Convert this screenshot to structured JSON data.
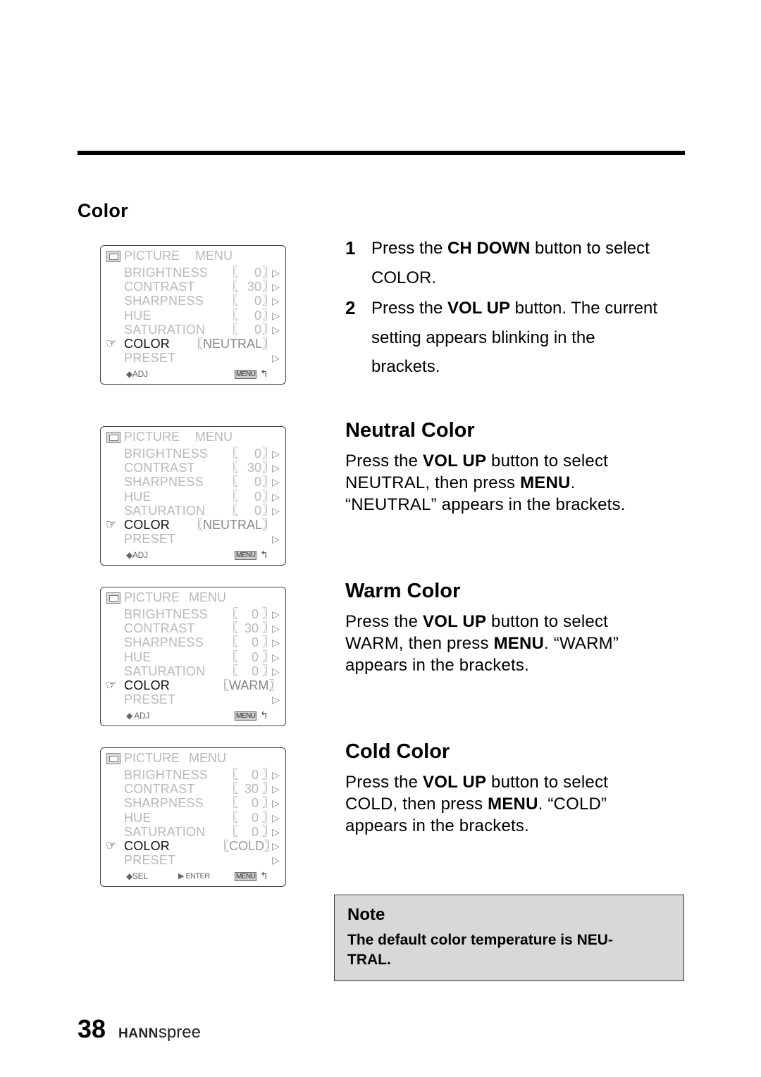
{
  "section": {
    "title": "Color"
  },
  "steps": [
    {
      "num": "1",
      "pre": "Press the ",
      "bold": "CH DOWN",
      "post": " button to select COLOR."
    },
    {
      "num": "2",
      "pre": "Press the ",
      "bold": "VOL UP",
      "post": " button. The current setting appears blinking in the brackets."
    }
  ],
  "osd_common": {
    "title_left": "PICTURE",
    "title_right": "MENU",
    "bracket_left": "〖",
    "bracket_right": "〗",
    "arrow": "▷",
    "hand_icon": "☞",
    "return_icon": "↰",
    "menu_key": "MENU",
    "rows": [
      {
        "label": "BRIGHTNESS",
        "value": "0"
      },
      {
        "label": "CONTRAST",
        "value": "30"
      },
      {
        "label": "SHARPNESS",
        "value": "0"
      },
      {
        "label": "HUE",
        "value": "0"
      },
      {
        "label": "SATURATION",
        "value": "0"
      }
    ],
    "color_label": "COLOR",
    "preset_label": "PRESET"
  },
  "osd_panels": [
    {
      "color_value": "NEUTRAL",
      "footer_left": "◆ADJ",
      "footer_mid": ""
    },
    {
      "color_value": "NEUTRAL",
      "footer_left": "◆ADJ",
      "footer_mid": ""
    },
    {
      "color_value": "WARM",
      "footer_left": "◆ ADJ",
      "footer_mid": ""
    },
    {
      "color_value": "COLD",
      "footer_left": "◆SEL",
      "footer_mid": "▶ ENTER"
    }
  ],
  "sections": [
    {
      "heading": "Neutral Color",
      "pre": "Press the ",
      "b1": "VOL UP",
      "mid": " button to select NEUTRAL, then press ",
      "b2": "MENU",
      "post": ". “NEUTRAL” appears in the brackets."
    },
    {
      "heading": "Warm Color",
      "pre": "Press the ",
      "b1": "VOL UP",
      "mid": " button to select WARM, then press ",
      "b2": "MENU",
      "post": ". “WARM” appears in the brackets."
    },
    {
      "heading": "Cold Color",
      "pre": "Press the ",
      "b1": "VOL UP",
      "mid": " button to select COLD, then press ",
      "b2": "MENU",
      "post": ". “COLD” appears in the brackets."
    }
  ],
  "note": {
    "title": "Note",
    "body": "The default color temperature is NEU- TRAL."
  },
  "footer": {
    "page_number": "38",
    "brand_bold": "HANN",
    "brand_light": "spree"
  }
}
